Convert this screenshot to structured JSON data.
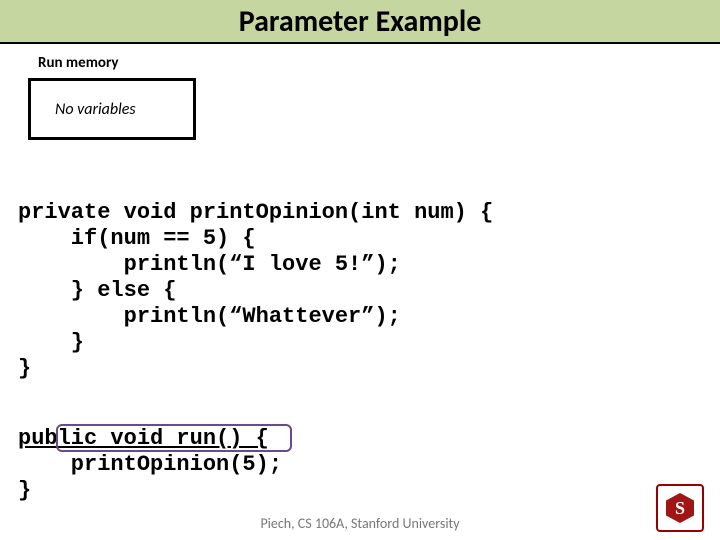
{
  "title": "Parameter Example",
  "memory": {
    "label": "Run memory",
    "content": "No variables"
  },
  "code": {
    "method1_l1": "private void printOpinion(int num) {",
    "method1_l2": "    if(num == 5) {",
    "method1_l3": "        println(“I love 5!”);",
    "method1_l4": "    } else {",
    "method1_l5": "        println(“Whattever”);",
    "method1_l6": "    }",
    "method1_l7": "}",
    "method2_l1": "public void run() {",
    "method2_l2": "    printOpinion(5);",
    "method2_l3": "}"
  },
  "footer": "Piech, CS 106A, Stanford University",
  "logo_letter": "S"
}
